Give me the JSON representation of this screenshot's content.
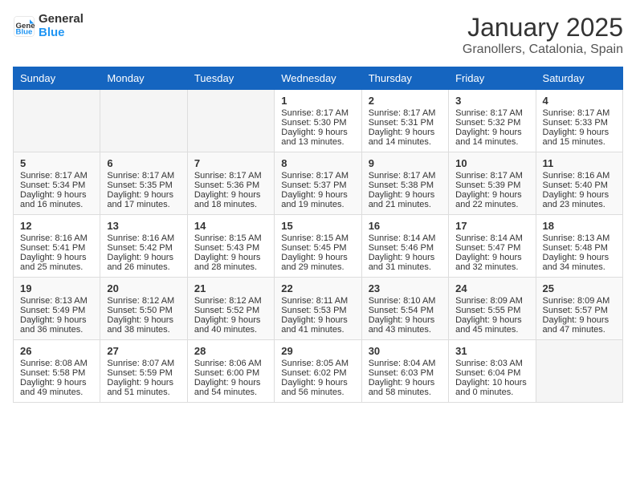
{
  "logo": {
    "text1": "General",
    "text2": "Blue"
  },
  "title": "January 2025",
  "subtitle": "Granollers, Catalonia, Spain",
  "days_of_week": [
    "Sunday",
    "Monday",
    "Tuesday",
    "Wednesday",
    "Thursday",
    "Friday",
    "Saturday"
  ],
  "weeks": [
    [
      {
        "day": "",
        "info": ""
      },
      {
        "day": "",
        "info": ""
      },
      {
        "day": "",
        "info": ""
      },
      {
        "day": "1",
        "info": "Sunrise: 8:17 AM\nSunset: 5:30 PM\nDaylight: 9 hours\nand 13 minutes."
      },
      {
        "day": "2",
        "info": "Sunrise: 8:17 AM\nSunset: 5:31 PM\nDaylight: 9 hours\nand 14 minutes."
      },
      {
        "day": "3",
        "info": "Sunrise: 8:17 AM\nSunset: 5:32 PM\nDaylight: 9 hours\nand 14 minutes."
      },
      {
        "day": "4",
        "info": "Sunrise: 8:17 AM\nSunset: 5:33 PM\nDaylight: 9 hours\nand 15 minutes."
      }
    ],
    [
      {
        "day": "5",
        "info": "Sunrise: 8:17 AM\nSunset: 5:34 PM\nDaylight: 9 hours\nand 16 minutes."
      },
      {
        "day": "6",
        "info": "Sunrise: 8:17 AM\nSunset: 5:35 PM\nDaylight: 9 hours\nand 17 minutes."
      },
      {
        "day": "7",
        "info": "Sunrise: 8:17 AM\nSunset: 5:36 PM\nDaylight: 9 hours\nand 18 minutes."
      },
      {
        "day": "8",
        "info": "Sunrise: 8:17 AM\nSunset: 5:37 PM\nDaylight: 9 hours\nand 19 minutes."
      },
      {
        "day": "9",
        "info": "Sunrise: 8:17 AM\nSunset: 5:38 PM\nDaylight: 9 hours\nand 21 minutes."
      },
      {
        "day": "10",
        "info": "Sunrise: 8:17 AM\nSunset: 5:39 PM\nDaylight: 9 hours\nand 22 minutes."
      },
      {
        "day": "11",
        "info": "Sunrise: 8:16 AM\nSunset: 5:40 PM\nDaylight: 9 hours\nand 23 minutes."
      }
    ],
    [
      {
        "day": "12",
        "info": "Sunrise: 8:16 AM\nSunset: 5:41 PM\nDaylight: 9 hours\nand 25 minutes."
      },
      {
        "day": "13",
        "info": "Sunrise: 8:16 AM\nSunset: 5:42 PM\nDaylight: 9 hours\nand 26 minutes."
      },
      {
        "day": "14",
        "info": "Sunrise: 8:15 AM\nSunset: 5:43 PM\nDaylight: 9 hours\nand 28 minutes."
      },
      {
        "day": "15",
        "info": "Sunrise: 8:15 AM\nSunset: 5:45 PM\nDaylight: 9 hours\nand 29 minutes."
      },
      {
        "day": "16",
        "info": "Sunrise: 8:14 AM\nSunset: 5:46 PM\nDaylight: 9 hours\nand 31 minutes."
      },
      {
        "day": "17",
        "info": "Sunrise: 8:14 AM\nSunset: 5:47 PM\nDaylight: 9 hours\nand 32 minutes."
      },
      {
        "day": "18",
        "info": "Sunrise: 8:13 AM\nSunset: 5:48 PM\nDaylight: 9 hours\nand 34 minutes."
      }
    ],
    [
      {
        "day": "19",
        "info": "Sunrise: 8:13 AM\nSunset: 5:49 PM\nDaylight: 9 hours\nand 36 minutes."
      },
      {
        "day": "20",
        "info": "Sunrise: 8:12 AM\nSunset: 5:50 PM\nDaylight: 9 hours\nand 38 minutes."
      },
      {
        "day": "21",
        "info": "Sunrise: 8:12 AM\nSunset: 5:52 PM\nDaylight: 9 hours\nand 40 minutes."
      },
      {
        "day": "22",
        "info": "Sunrise: 8:11 AM\nSunset: 5:53 PM\nDaylight: 9 hours\nand 41 minutes."
      },
      {
        "day": "23",
        "info": "Sunrise: 8:10 AM\nSunset: 5:54 PM\nDaylight: 9 hours\nand 43 minutes."
      },
      {
        "day": "24",
        "info": "Sunrise: 8:09 AM\nSunset: 5:55 PM\nDaylight: 9 hours\nand 45 minutes."
      },
      {
        "day": "25",
        "info": "Sunrise: 8:09 AM\nSunset: 5:57 PM\nDaylight: 9 hours\nand 47 minutes."
      }
    ],
    [
      {
        "day": "26",
        "info": "Sunrise: 8:08 AM\nSunset: 5:58 PM\nDaylight: 9 hours\nand 49 minutes."
      },
      {
        "day": "27",
        "info": "Sunrise: 8:07 AM\nSunset: 5:59 PM\nDaylight: 9 hours\nand 51 minutes."
      },
      {
        "day": "28",
        "info": "Sunrise: 8:06 AM\nSunset: 6:00 PM\nDaylight: 9 hours\nand 54 minutes."
      },
      {
        "day": "29",
        "info": "Sunrise: 8:05 AM\nSunset: 6:02 PM\nDaylight: 9 hours\nand 56 minutes."
      },
      {
        "day": "30",
        "info": "Sunrise: 8:04 AM\nSunset: 6:03 PM\nDaylight: 9 hours\nand 58 minutes."
      },
      {
        "day": "31",
        "info": "Sunrise: 8:03 AM\nSunset: 6:04 PM\nDaylight: 10 hours\nand 0 minutes."
      },
      {
        "day": "",
        "info": ""
      }
    ]
  ]
}
